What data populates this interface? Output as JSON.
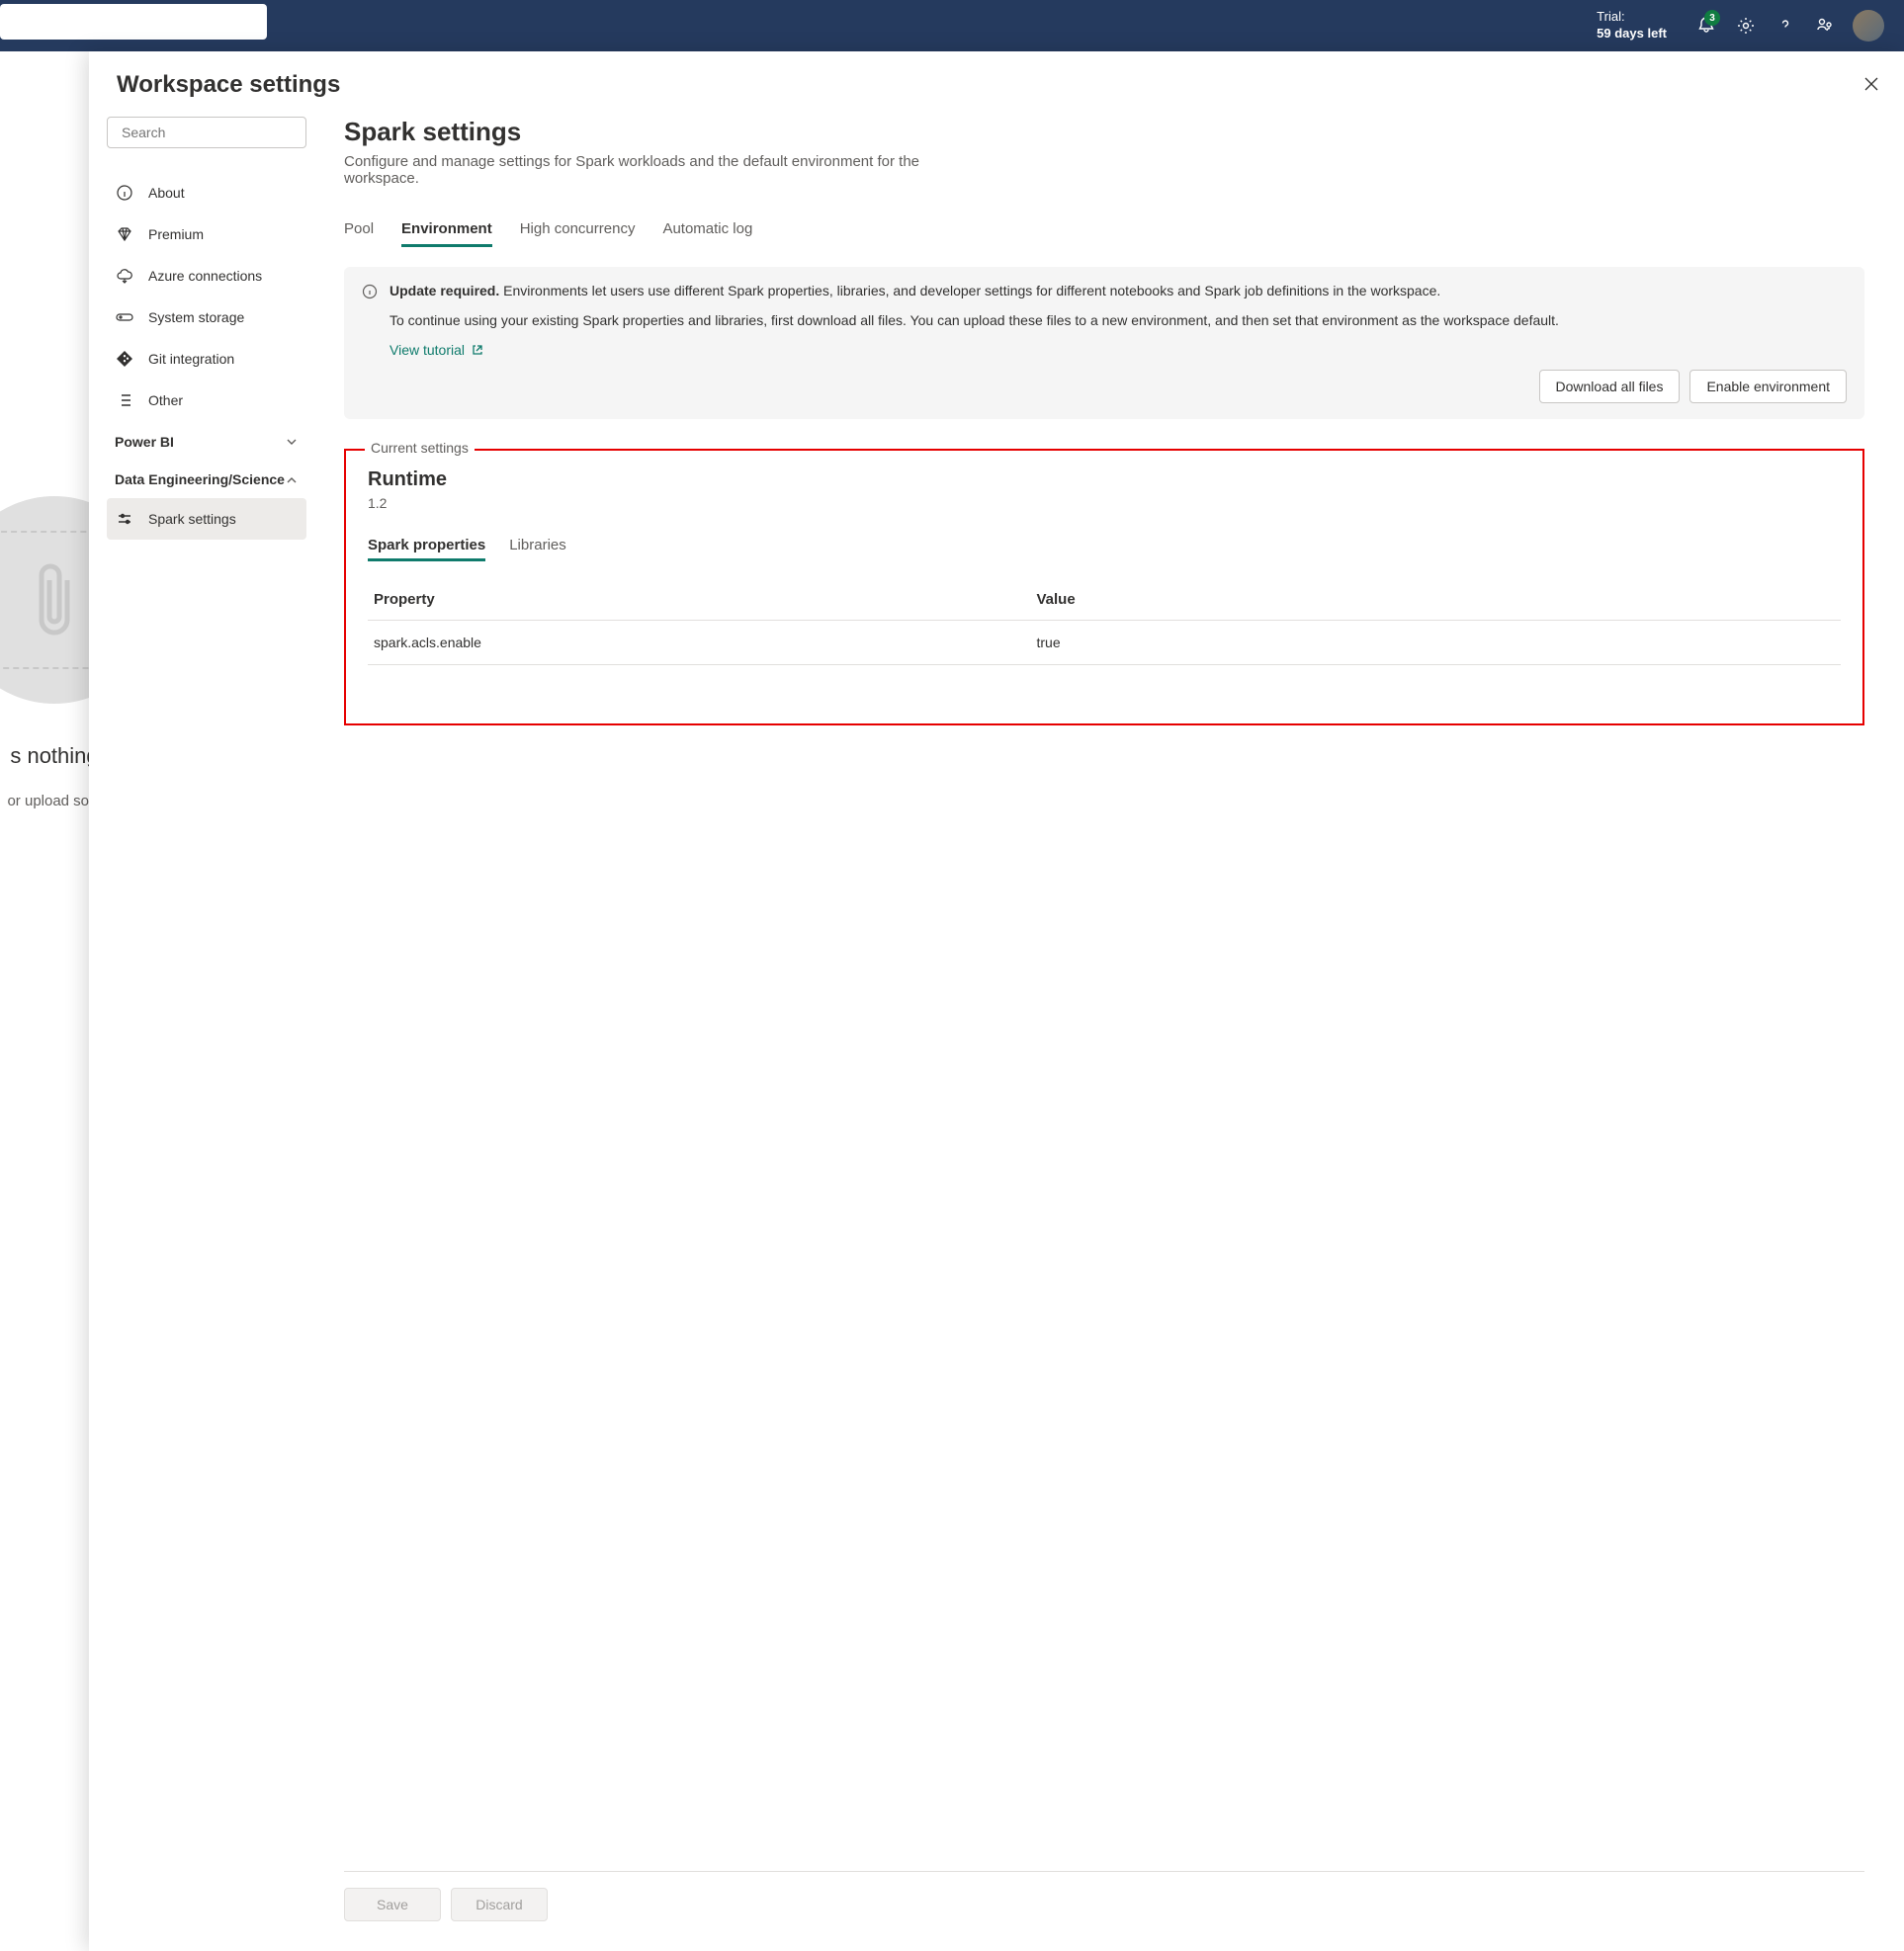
{
  "topbar": {
    "trial_label": "Trial:",
    "trial_days": "59 days left",
    "notif_count": "3"
  },
  "bg": {
    "heading": "s nothing",
    "sub": "or upload som"
  },
  "panel_title": "Workspace settings",
  "search_placeholder": "Search",
  "nav": {
    "about": "About",
    "premium": "Premium",
    "azure": "Azure connections",
    "storage": "System storage",
    "git": "Git integration",
    "other": "Other",
    "powerbi": "Power BI",
    "de": "Data Engineering/Science",
    "spark": "Spark settings"
  },
  "content": {
    "title": "Spark settings",
    "desc": "Configure and manage settings for Spark workloads and the default environment for the workspace."
  },
  "tabs": {
    "pool": "Pool",
    "environment": "Environment",
    "highc": "High concurrency",
    "auto": "Automatic log"
  },
  "callout": {
    "strong": "Update required.",
    "p1_rest": " Environments let users use different Spark properties, libraries, and developer settings for different notebooks and Spark job definitions in the workspace.",
    "p2": "To continue using your existing Spark properties and libraries, first download all files. You can upload these files to a new environment, and then set that environment as the workspace default.",
    "tutorial": "View tutorial",
    "btn_download": "Download all files",
    "btn_enable": "Enable environment"
  },
  "fieldset_label": "Current settings",
  "runtime": {
    "title": "Runtime",
    "version": "1.2",
    "subtab_props": "Spark properties",
    "subtab_libs": "Libraries",
    "col_property": "Property",
    "col_value": "Value",
    "rows": [
      {
        "property": "spark.acls.enable",
        "value": "true"
      }
    ]
  },
  "actions": {
    "save": "Save",
    "discard": "Discard"
  }
}
